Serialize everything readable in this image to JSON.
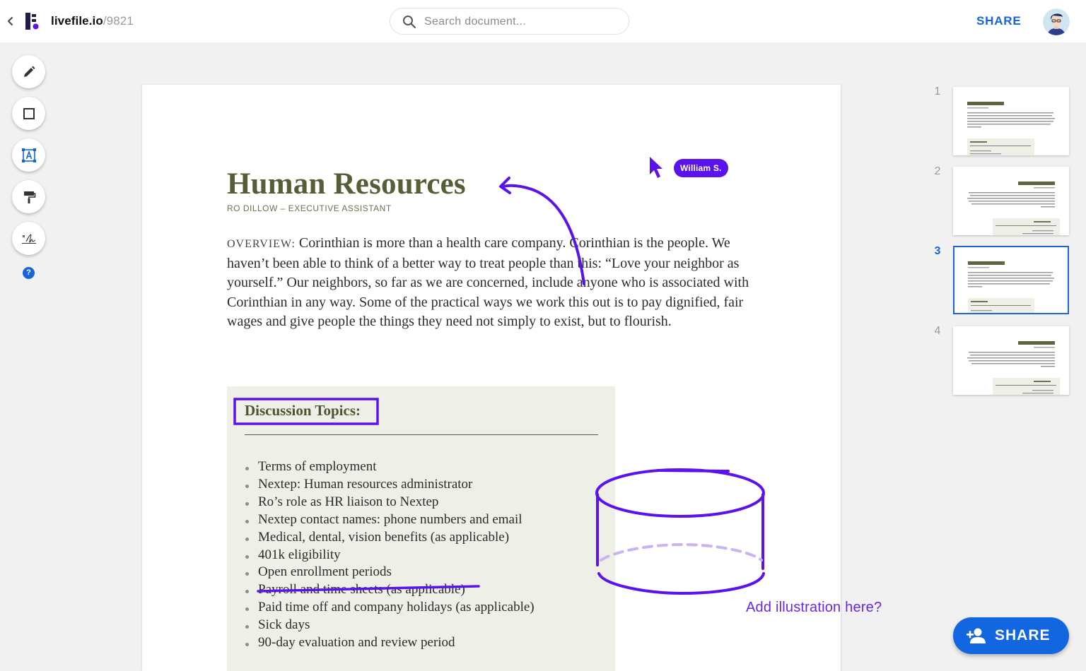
{
  "header": {
    "brand": "livefile.io",
    "doc_id": "/9821",
    "search_placeholder": "Search document...",
    "share_label": "SHARE"
  },
  "tools": [
    {
      "name": "pencil-icon"
    },
    {
      "name": "rectangle-icon"
    },
    {
      "name": "text-box-icon"
    },
    {
      "name": "paint-roller-icon"
    },
    {
      "name": "signature-icon"
    }
  ],
  "help_label": "?",
  "document": {
    "title": "Human Resources",
    "subtitle": "RO DILLOW – EXECUTIVE ASSISTANT",
    "overview_label": "OVERVIEW:",
    "overview_text": " Corinthian is more than a health care company. Corinthian is the people. We haven’t been able to think of a better way to treat people than this: “Love your neighbor as yourself.” Our neighbors, so far as we are concerned, include anyone who is associated with Corinthian in any way. Some of the practical ways we work this out is to pay dignified, fair wages and give people the things they need not simply to exist, but to flourish.",
    "topics_heading": "Discussion Topics:",
    "topics": [
      "Terms of employment",
      "Nextep: Human resources administrator",
      "Ro’s role as HR liaison to Nextep",
      "Nextep contact names: phone numbers and email",
      "Medical, dental, vision benefits (as applicable)",
      "401k eligibility",
      "Open enrollment periods",
      "Payroll and time sheets (as applicable)",
      "Paid time off and company holidays (as applicable)",
      "Sick days",
      "90-day evaluation and review period"
    ]
  },
  "annotations": {
    "collaborator": "William S.",
    "note": "Add illustration here?",
    "color": "#5b13ee"
  },
  "thumbnails": {
    "pages": [
      "1",
      "2",
      "3",
      "4"
    ],
    "active": "3"
  },
  "fab": {
    "label": "SHARE"
  },
  "colors": {
    "accent": "#1565d8",
    "annotation": "#5b13ee",
    "title_olive": "#545f38",
    "topics_bg": "#eef0e8"
  }
}
